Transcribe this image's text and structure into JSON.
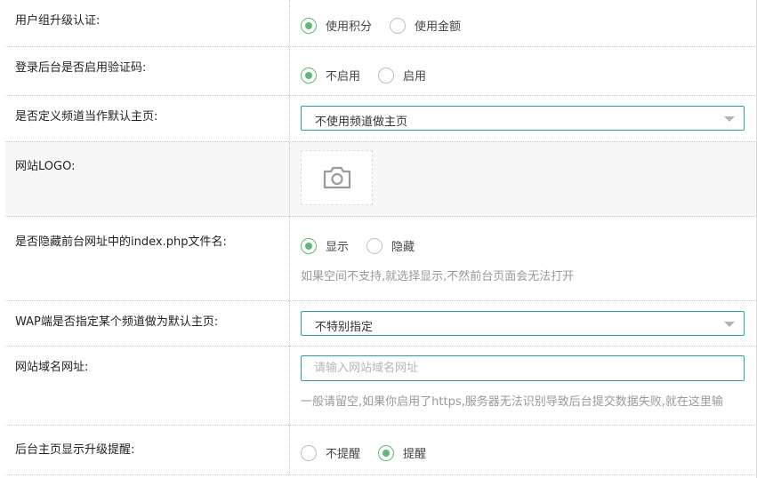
{
  "rows": {
    "score": {
      "label": "用户组升级认证:",
      "opt1": "使用积分",
      "opt2": "使用金额",
      "selected": "使用积分"
    },
    "captcha": {
      "label": "登录后台是否启用验证码:",
      "opt1": "不启用",
      "opt2": "启用",
      "selected": "不启用"
    },
    "homepage": {
      "label": "是否定义频道当作默认主页:",
      "value": "不使用频道做主页"
    },
    "logo": {
      "label": "网站LOGO:",
      "icon": "camera-icon"
    },
    "indexphp": {
      "label": "是否隐藏前台网址中的index.php文件名:",
      "opt1": "显示",
      "opt2": "隐藏",
      "selected": "显示",
      "hint": "如果空间不支持,就选择显示,不然前台页面会无法打开"
    },
    "wap": {
      "label": "WAP端是否指定某个频道做为默认主页:",
      "value": "不特别指定"
    },
    "domain": {
      "label": "网站域名网址:",
      "placeholder": "请输入网站域名网址",
      "value": "",
      "hint": "一般请留空,如果你启用了https,服务器无法识别导致后台提交数据失败,就在这里输"
    },
    "upgrade": {
      "label": "后台主页显示升级提醒:",
      "opt1": "不提醒",
      "opt2": "提醒",
      "selected": "提醒"
    }
  },
  "colors": {
    "accent": "#5fb878",
    "input_border": "#2e9fa5",
    "hint": "#999999"
  }
}
